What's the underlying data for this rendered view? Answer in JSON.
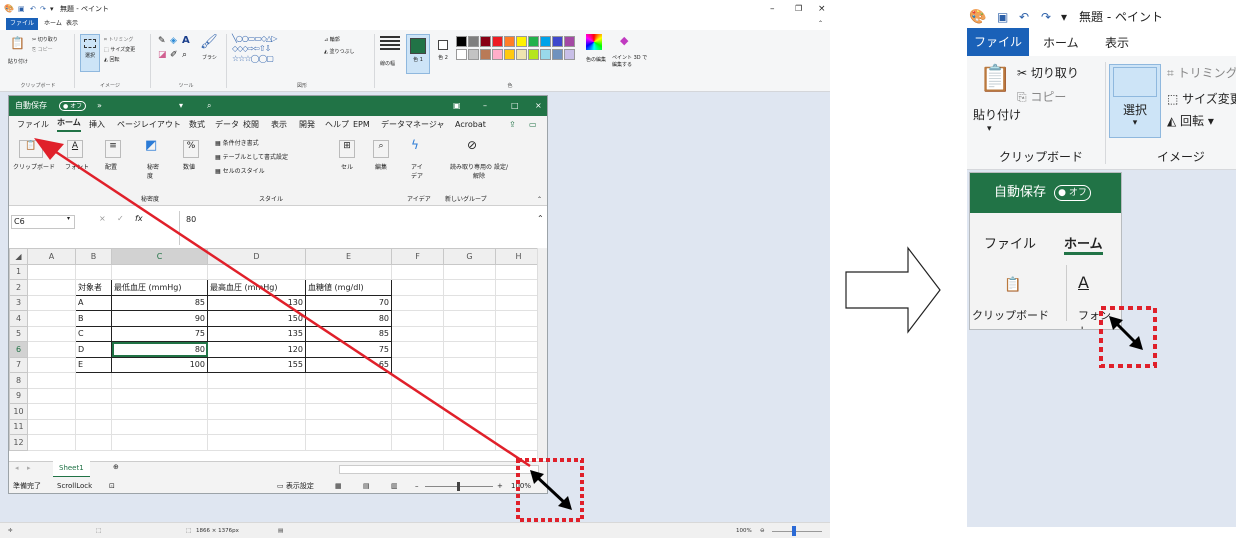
{
  "paint": {
    "title": "無題 - ペイント",
    "tabs": [
      "ファイル",
      "ホーム",
      "表示"
    ],
    "ribbon": {
      "paste_label": "貼り付け",
      "cut_label": "切り取り",
      "copy_label": "コピー",
      "select_label": "選択",
      "crop_label": "トリミング",
      "resize_label": "サイズ変更",
      "rotate_label": "回転",
      "brush_label": "ブラシ",
      "outline_label": "輪郭",
      "fill_label": "塗りつぶし",
      "line_width_label": "線の幅",
      "color1_label": "色 1",
      "color2_label": "色 2",
      "edit_colors_label": "色の編集",
      "paint3d_label": "ペイント 3D で編集する",
      "group_clipboard": "クリップボード",
      "group_image": "イメージ",
      "group_tools": "ツール",
      "group_shapes": "図形",
      "group_colors": "色"
    },
    "status": {
      "dimensions": "1866 × 1376px",
      "zoom": "100%"
    },
    "palette": [
      "#000000",
      "#7f7f7f",
      "#880015",
      "#ed1c24",
      "#ff7f27",
      "#fff200",
      "#22b14c",
      "#00a2e8",
      "#3f48cc",
      "#a349a4",
      "#ffffff",
      "#c3c3c3",
      "#b97a57",
      "#ffaec9",
      "#ffc90e",
      "#efe4b0",
      "#b5e61d",
      "#99d9ea",
      "#7092be",
      "#c8bfe7"
    ],
    "color1": "#217346",
    "color2": "#ffffff"
  },
  "excel": {
    "autosave_label": "自動保存",
    "autosave_state": "オフ",
    "tabs": [
      "ファイル",
      "ホーム",
      "挿入",
      "ページレイアウト",
      "数式",
      "データ",
      "校閲",
      "表示",
      "開発",
      "ヘルプ",
      "EPM",
      "データマネージャ",
      "Acrobat"
    ],
    "ribbon": {
      "clipboard": "クリップボード",
      "font": "フォント",
      "alignment": "配置",
      "confidentiality": "秘密度",
      "confidentiality_group": "秘密度",
      "number": "数値",
      "conditional_format": "条件付き書式",
      "format_as_table": "テーブルとして書式設定",
      "cell_styles": "セルのスタイル",
      "styles_group": "スタイル",
      "cells": "セル",
      "editing": "編集",
      "ideas": "アイ デア",
      "ideas_group": "アイデア",
      "readonly": "読み取り専用の 設定/解除",
      "new_group": "新しいグループ"
    },
    "name_box": "C6",
    "formula": "80",
    "columns": [
      "A",
      "B",
      "C",
      "D",
      "E",
      "F",
      "G",
      "H"
    ],
    "rows": [
      "1",
      "2",
      "3",
      "4",
      "5",
      "6",
      "7",
      "8",
      "9",
      "10",
      "11",
      "12"
    ],
    "headers": [
      "対象者",
      "最低血圧 (mmHg)",
      "最高血圧 (mmHg)",
      "血糖値 (mg/dl)"
    ],
    "data": [
      [
        "A",
        "85",
        "130",
        "70"
      ],
      [
        "B",
        "90",
        "150",
        "80"
      ],
      [
        "C",
        "75",
        "135",
        "85"
      ],
      [
        "D",
        "80",
        "120",
        "75"
      ],
      [
        "E",
        "100",
        "155",
        "65"
      ]
    ],
    "sheet_tab": "Sheet1",
    "status_ready": "準備完了",
    "status_scrolllock": "ScrollLock",
    "display_settings": "表示設定",
    "zoom": "100%"
  },
  "colors": {
    "excel_green": "#217346",
    "annotation_red": "#e0202a",
    "paint_blue": "#1a61b8"
  }
}
